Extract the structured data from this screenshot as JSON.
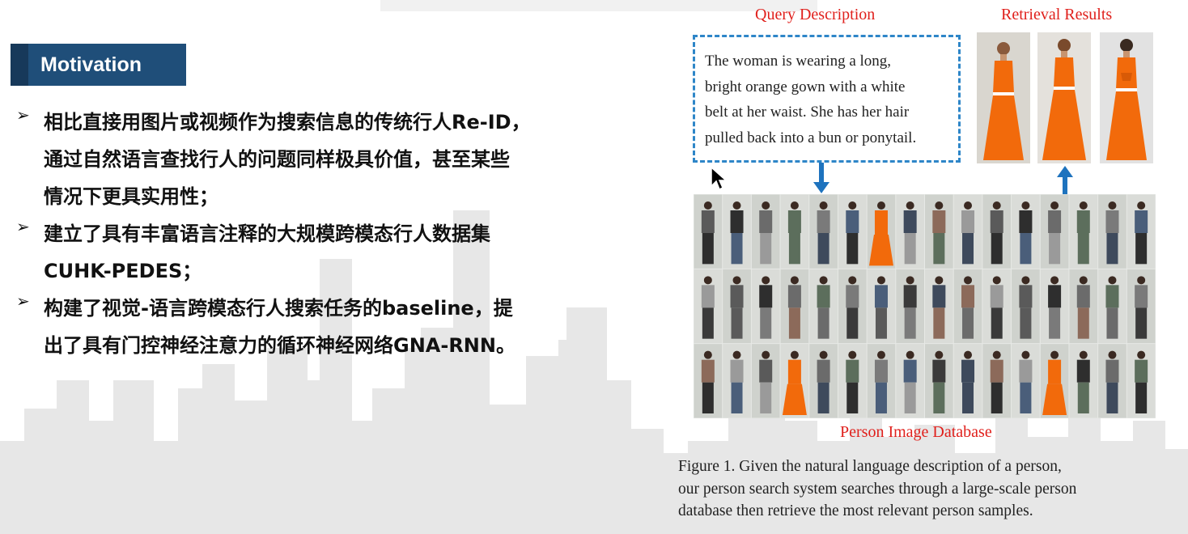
{
  "section": {
    "title": "Motivation"
  },
  "bullets": [
    {
      "lines": [
        "相比直接用图片或视频作为搜索信息的传统行人Re-ID，",
        "通过自然语言查找行人的问题同样极具价值，甚至某些",
        "情况下更具实用性；"
      ]
    },
    {
      "lines": [
        "建立了具有丰富语言注释的大规模跨模态行人数据集",
        "CUHK-PEDES；"
      ]
    },
    {
      "lines": [
        "构建了视觉-语言跨模态行人搜索任务的baseline，提",
        "出了具有门控神经注意力的循环神经网络GNA-RNN。"
      ]
    }
  ],
  "bullet_marker": "➢",
  "figure": {
    "query_label": "Query Description",
    "retrieval_label": "Retrieval Results",
    "database_label": "Person Image Database",
    "query_lines": [
      "The woman is wearing a long,",
      "bright orange gown with a white",
      "belt at her waist. She has her hair",
      "pulled back into a bun or ponytail."
    ],
    "caption_lines": [
      "Figure 1. Given the natural language description of a person,",
      "our person search system searches through a large-scale person",
      "database then retrieve the most relevant person samples."
    ],
    "colors": {
      "label_red": "#e0201c",
      "dash_blue": "#2e86c8",
      "arrow_blue": "#1e73be",
      "gown_orange": "#f26a0b",
      "header_blue": "#1f4e79"
    }
  }
}
